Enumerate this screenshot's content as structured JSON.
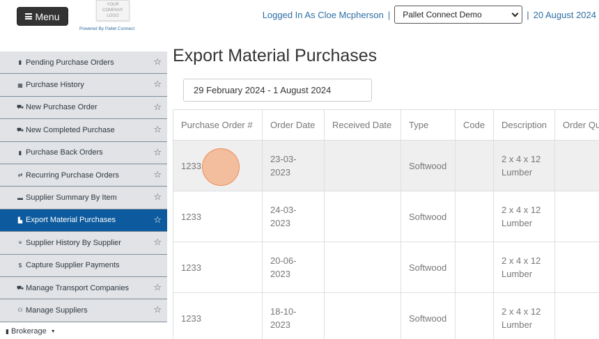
{
  "header": {
    "menu_label": "Menu",
    "logo_lines": [
      "YOUR",
      "COMPANY",
      "LOGO"
    ],
    "powered_by": "Powered By Pallet Connect",
    "logged_in": "Logged In As Cloe Mcpherson",
    "separator": "|",
    "company_selected": "Pallet Connect Demo",
    "date": "20 August 2024"
  },
  "sidebar": {
    "items": [
      {
        "label": "Pending Purchase Orders",
        "icon": "clipboard-icon",
        "glyph": "▮",
        "starred": true,
        "active": false
      },
      {
        "label": "Purchase History",
        "icon": "table-icon",
        "glyph": "▦",
        "starred": true,
        "active": false
      },
      {
        "label": "New Purchase Order",
        "icon": "dolly-icon",
        "glyph": "⛟",
        "starred": true,
        "active": false
      },
      {
        "label": "New Completed Purchase",
        "icon": "truck-icon",
        "glyph": "⛟",
        "starred": true,
        "active": false
      },
      {
        "label": "Purchase Back Orders",
        "icon": "clipboard-icon",
        "glyph": "▮",
        "starred": true,
        "active": false
      },
      {
        "label": "Recurring Purchase Orders",
        "icon": "repeat-icon",
        "glyph": "⇄",
        "starred": true,
        "active": false
      },
      {
        "label": "Supplier Summary By Item",
        "icon": "pallet-icon",
        "glyph": "▬",
        "starred": true,
        "active": false
      },
      {
        "label": "Export Material Purchases",
        "icon": "file-export-icon",
        "glyph": "▙",
        "starred": true,
        "active": true
      },
      {
        "label": "Supplier History By Supplier",
        "icon": "list-icon",
        "glyph": "≡",
        "starred": true,
        "active": false
      },
      {
        "label": "Capture Supplier Payments",
        "icon": "dollar-icon",
        "glyph": "$",
        "starred": false,
        "active": false
      },
      {
        "label": "Manage Transport Companies",
        "icon": "truck-icon",
        "glyph": "⛟",
        "starred": true,
        "active": false
      },
      {
        "label": "Manage Suppliers",
        "icon": "users-icon",
        "glyph": "⚇",
        "starred": true,
        "active": false
      }
    ],
    "brokerage_label": "Brokerage"
  },
  "main": {
    "title": "Export Material Purchases",
    "date_range": "29 February 2024 - 1 August 2024",
    "columns": [
      "Purchase Order #",
      "Order Date",
      "Received Date",
      "Type",
      "Code",
      "Description",
      "Order Qu"
    ],
    "rows": [
      {
        "po": "1233",
        "order_date": [
          "23-03-",
          "2023"
        ],
        "received": "",
        "type": "Softwood",
        "code": "",
        "description": [
          "2 x 4 x 12",
          "Lumber"
        ],
        "qty": ""
      },
      {
        "po": "1233",
        "order_date": [
          "24-03-",
          "2023"
        ],
        "received": "",
        "type": "Softwood",
        "code": "",
        "description": [
          "2 x 4 x 12",
          "Lumber"
        ],
        "qty": ""
      },
      {
        "po": "1233",
        "order_date": [
          "20-06-",
          "2023"
        ],
        "received": "",
        "type": "Softwood",
        "code": "",
        "description": [
          "2 x 4 x 12",
          "Lumber"
        ],
        "qty": ""
      },
      {
        "po": "1233",
        "order_date": [
          "18-10-",
          "2023"
        ],
        "received": "",
        "type": "Softwood",
        "code": "",
        "description": [
          "2 x 4 x 12",
          "Lumber"
        ],
        "qty": ""
      }
    ]
  },
  "colors": {
    "active_item": "#0d5b9e",
    "sidebar_bg": "#e1e3e6",
    "link_blue": "#2d6ea3",
    "menu_button": "#333333",
    "click_marker": "#f5965a"
  }
}
